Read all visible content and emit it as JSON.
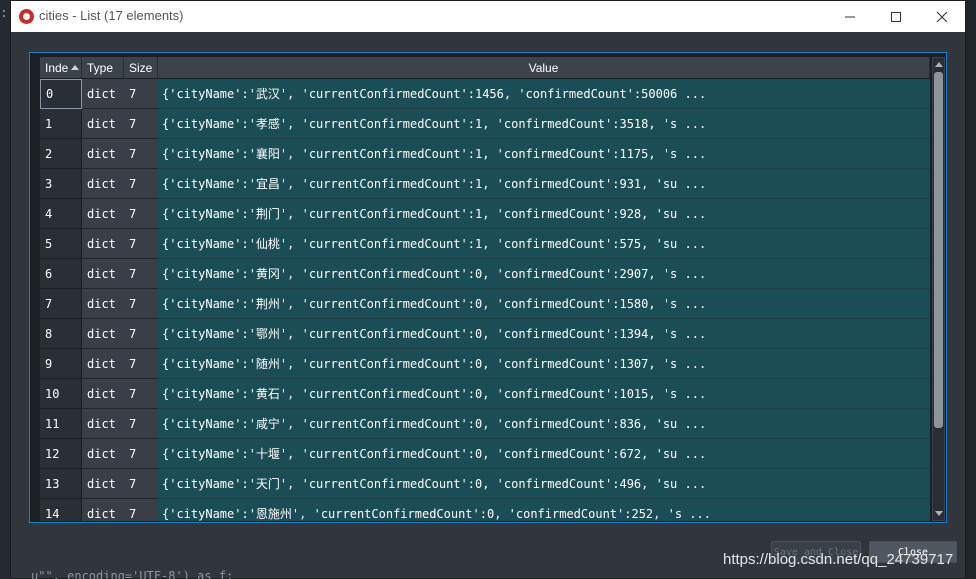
{
  "window": {
    "title": "cities - List (17 elements)"
  },
  "table": {
    "headers": {
      "index": "Inde",
      "type": "Type",
      "size": "Size",
      "value": "Value"
    },
    "rows": [
      {
        "index": "0",
        "type": "dict",
        "size": "7",
        "value": "{'cityName':'武汉', 'currentConfirmedCount':1456, 'confirmedCount':50006 ..."
      },
      {
        "index": "1",
        "type": "dict",
        "size": "7",
        "value": "{'cityName':'孝感', 'currentConfirmedCount':1, 'confirmedCount':3518, 's ..."
      },
      {
        "index": "2",
        "type": "dict",
        "size": "7",
        "value": "{'cityName':'襄阳', 'currentConfirmedCount':1, 'confirmedCount':1175, 's ..."
      },
      {
        "index": "3",
        "type": "dict",
        "size": "7",
        "value": "{'cityName':'宜昌', 'currentConfirmedCount':1, 'confirmedCount':931, 'su ..."
      },
      {
        "index": "4",
        "type": "dict",
        "size": "7",
        "value": "{'cityName':'荆门', 'currentConfirmedCount':1, 'confirmedCount':928, 'su ..."
      },
      {
        "index": "5",
        "type": "dict",
        "size": "7",
        "value": "{'cityName':'仙桃', 'currentConfirmedCount':1, 'confirmedCount':575, 'su ..."
      },
      {
        "index": "6",
        "type": "dict",
        "size": "7",
        "value": "{'cityName':'黄冈', 'currentConfirmedCount':0, 'confirmedCount':2907, 's ..."
      },
      {
        "index": "7",
        "type": "dict",
        "size": "7",
        "value": "{'cityName':'荆州', 'currentConfirmedCount':0, 'confirmedCount':1580, 's ..."
      },
      {
        "index": "8",
        "type": "dict",
        "size": "7",
        "value": "{'cityName':'鄂州', 'currentConfirmedCount':0, 'confirmedCount':1394, 's ..."
      },
      {
        "index": "9",
        "type": "dict",
        "size": "7",
        "value": "{'cityName':'随州', 'currentConfirmedCount':0, 'confirmedCount':1307, 's ..."
      },
      {
        "index": "10",
        "type": "dict",
        "size": "7",
        "value": "{'cityName':'黄石', 'currentConfirmedCount':0, 'confirmedCount':1015, 's ..."
      },
      {
        "index": "11",
        "type": "dict",
        "size": "7",
        "value": "{'cityName':'咸宁', 'currentConfirmedCount':0, 'confirmedCount':836, 'su ..."
      },
      {
        "index": "12",
        "type": "dict",
        "size": "7",
        "value": "{'cityName':'十堰', 'currentConfirmedCount':0, 'confirmedCount':672, 'su ..."
      },
      {
        "index": "13",
        "type": "dict",
        "size": "7",
        "value": "{'cityName':'天门', 'currentConfirmedCount':0, 'confirmedCount':496, 'su ..."
      },
      {
        "index": "14",
        "type": "dict",
        "size": "7",
        "value": "{'cityName':'恩施州', 'currentConfirmedCount':0, 'confirmedCount':252, 's ..."
      }
    ]
  },
  "buttons": {
    "save_close": "Save and Close",
    "close": "Close"
  },
  "watermark": "https://blog.csdn.net/qq_24739717",
  "background_code": "u\"\", encoding='UTF-8') as f:",
  "colors": {
    "value_cell": "#1b4d56",
    "frame_accent": "#1c80c4",
    "window_bg": "#31363d"
  }
}
